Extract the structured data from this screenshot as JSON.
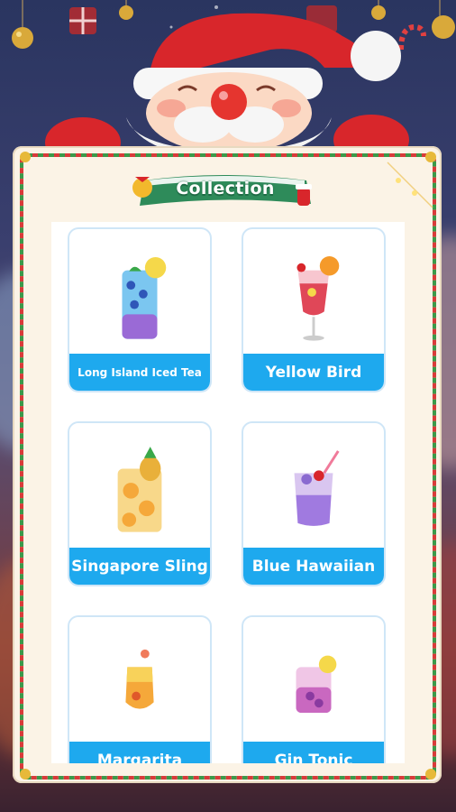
{
  "header": {
    "title": "Collection"
  },
  "cocktails": [
    {
      "name": "Long Island Iced Tea",
      "icon": "long-island-iced-tea-drink-icon"
    },
    {
      "name": "Yellow Bird",
      "icon": "yellow-bird-drink-icon"
    },
    {
      "name": "Singapore Sling",
      "icon": "singapore-sling-drink-icon"
    },
    {
      "name": "Blue Hawaiian",
      "icon": "blue-hawaiian-drink-icon"
    },
    {
      "name": "Margarita",
      "icon": "margarita-drink-icon"
    },
    {
      "name": "Gin Tonic",
      "icon": "gin-tonic-drink-icon"
    }
  ],
  "colors": {
    "label_blue": "#1ea9ee",
    "banner_green": "#2e8b5a",
    "board_cream": "#fbf3e6",
    "santa_red": "#d8262b"
  }
}
